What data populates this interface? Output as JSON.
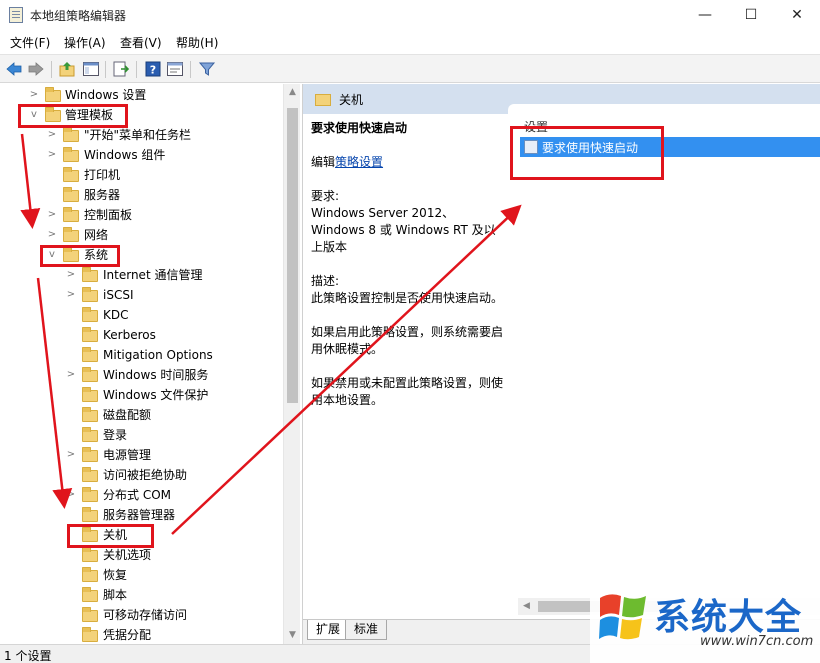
{
  "window": {
    "title": "本地组策略编辑器",
    "controls": {
      "minimize": "—",
      "maximize": "☐",
      "close": "✕"
    }
  },
  "menu": {
    "items": [
      {
        "label": "文件(F)"
      },
      {
        "label": "操作(A)"
      },
      {
        "label": "查看(V)"
      },
      {
        "label": "帮助(H)"
      }
    ]
  },
  "toolbar": {
    "icons": [
      "back-arrow-icon",
      "forward-arrow-icon",
      "up-folder-icon",
      "show-hide-tree-icon",
      "export-list-icon",
      "help-icon",
      "properties-icon",
      "filter-icon"
    ]
  },
  "tree": {
    "items": [
      {
        "label": "Windows 设置",
        "expanded": false
      },
      {
        "label": "管理模板",
        "expanded": true
      },
      {
        "label": "\"开始\"菜单和任务栏",
        "expanded": false
      },
      {
        "label": "Windows 组件",
        "expanded": false
      },
      {
        "label": "打印机",
        "expanded": false
      },
      {
        "label": "服务器",
        "expanded": false
      },
      {
        "label": "控制面板",
        "expanded": false
      },
      {
        "label": "网络",
        "expanded": false
      },
      {
        "label": "系统",
        "expanded": true
      },
      {
        "label": "Internet 通信管理",
        "expanded": false
      },
      {
        "label": "iSCSI",
        "expanded": false
      },
      {
        "label": "KDC",
        "expanded": false
      },
      {
        "label": "Kerberos",
        "expanded": false
      },
      {
        "label": "Mitigation Options",
        "expanded": false
      },
      {
        "label": "Windows 时间服务",
        "expanded": false
      },
      {
        "label": "Windows 文件保护",
        "expanded": false
      },
      {
        "label": "磁盘配额",
        "expanded": false
      },
      {
        "label": "登录",
        "expanded": false
      },
      {
        "label": "电源管理",
        "expanded": false
      },
      {
        "label": "访问被拒绝协助",
        "expanded": false
      },
      {
        "label": "分布式 COM",
        "expanded": false
      },
      {
        "label": "服务器管理器",
        "expanded": false
      },
      {
        "label": "关机",
        "expanded": false,
        "selected": true
      },
      {
        "label": "关机选项",
        "expanded": false
      },
      {
        "label": "恢复",
        "expanded": false
      },
      {
        "label": "脚本",
        "expanded": false
      },
      {
        "label": "可移动存储访问",
        "expanded": false
      },
      {
        "label": "凭据分配",
        "expanded": false
      }
    ]
  },
  "right_pane": {
    "header_title": "关机",
    "description": {
      "heading": "要求使用快速启动",
      "edit_prefix": "编辑",
      "edit_link": "策略设置",
      "requirements_label": "要求:",
      "requirements_text": "Windows Server 2012、Windows 8 或 Windows RT 及以上版本",
      "description_label": "描述:",
      "description_text": "此策略设置控制是否使用快速启动。",
      "enabled_text": "如果启用此策略设置，则系统需要启用休眠模式。",
      "disabled_text": "如果禁用或未配置此策略设置，则使用本地设置。"
    },
    "list": {
      "column_header": "设置",
      "selected_item": "要求使用快速启动"
    },
    "tabs": [
      {
        "label": "扩展"
      },
      {
        "label": "标准"
      }
    ]
  },
  "status": {
    "text": "1 个设置"
  },
  "watermark": {
    "title": "系统大全",
    "url": "www.win7cn.com"
  },
  "colors": {
    "annotation_red": "#e0141c",
    "selection_blue": "#3390f0",
    "header_blue": "#d4e0ef"
  }
}
